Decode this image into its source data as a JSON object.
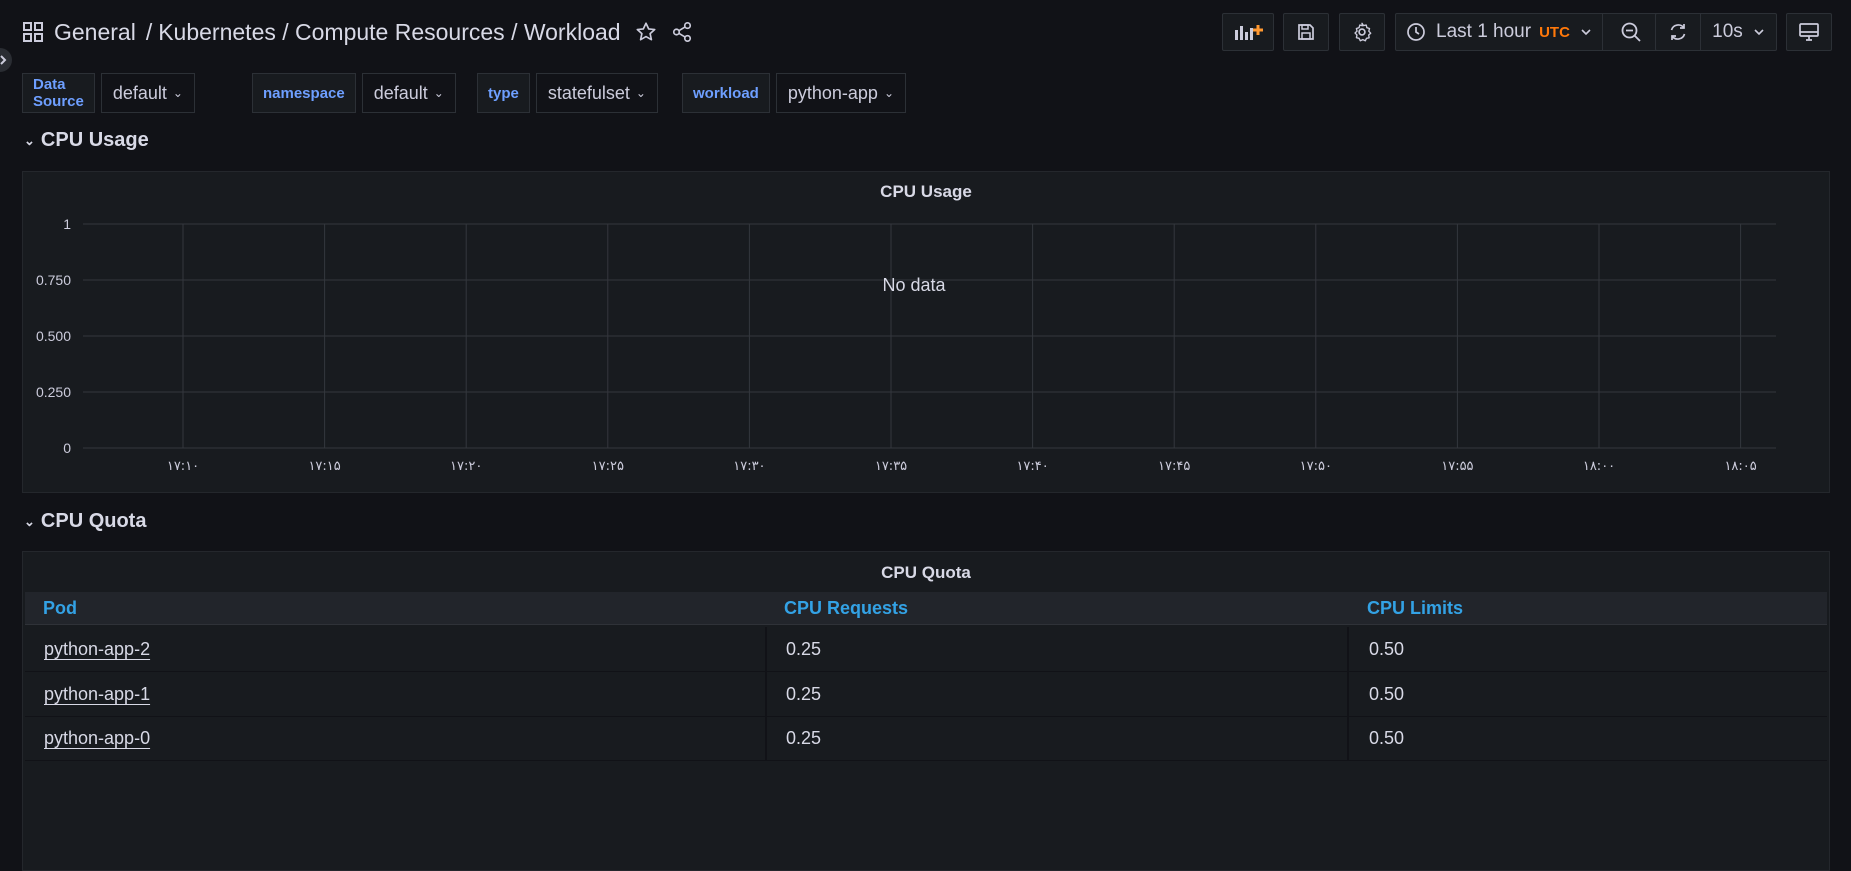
{
  "breadcrumb": {
    "root": "General",
    "separator": "/",
    "rest": "Kubernetes / Compute Resources / Workload"
  },
  "toolbar": {
    "time_range": "Last 1 hour",
    "timezone": "UTC",
    "refresh_interval": "10s"
  },
  "variables": [
    {
      "label": "Data Source",
      "value": "default"
    },
    {
      "label": "namespace",
      "value": "default"
    },
    {
      "label": "type",
      "value": "statefulset"
    },
    {
      "label": "workload",
      "value": "python-app"
    }
  ],
  "rows": {
    "cpu_usage": "CPU Usage",
    "cpu_quota": "CPU Quota"
  },
  "cpu_usage_panel": {
    "title": "CPU Usage",
    "no_data": "No data"
  },
  "chart_data": {
    "type": "line",
    "title": "CPU Usage",
    "series": [],
    "ylim": [
      0,
      1
    ],
    "yticks": [
      "0",
      "0.250",
      "0.500",
      "0.750",
      "1"
    ],
    "xticks": [
      "۱۷:۱۰",
      "۱۷:۱۵",
      "۱۷:۲۰",
      "۱۷:۲۵",
      "۱۷:۳۰",
      "۱۷:۳۵",
      "۱۷:۴۰",
      "۱۷:۴۵",
      "۱۷:۵۰",
      "۱۷:۵۵",
      "۱۸:۰۰",
      "۱۸:۰۵"
    ],
    "grid": true,
    "annotation": "No data"
  },
  "cpu_quota_panel": {
    "title": "CPU Quota",
    "columns": [
      "Pod",
      "CPU Requests",
      "CPU Limits"
    ],
    "rows": [
      [
        "python-app-2",
        "0.25",
        "0.50"
      ],
      [
        "python-app-1",
        "0.25",
        "0.50"
      ],
      [
        "python-app-0",
        "0.25",
        "0.50"
      ]
    ]
  },
  "colors": {
    "background": "#111217",
    "panel": "#181b1f",
    "variable_label": "#6e9fff",
    "column_header": "#33a2e5",
    "timezone": "#ff780a"
  }
}
